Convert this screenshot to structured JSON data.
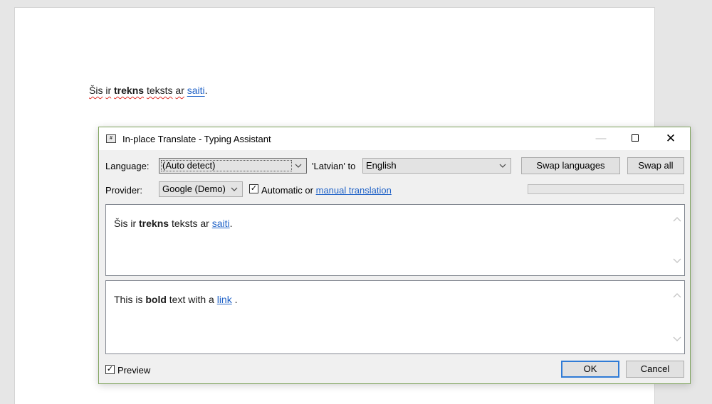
{
  "document": {
    "word_sis": "Šis",
    "word_ir": "ir",
    "word_trekns": "trekns",
    "word_teksts": "teksts",
    "word_ar": "ar",
    "word_saiti": "saiti",
    "punct": "."
  },
  "dialog": {
    "title": "In-place Translate - Typing Assistant",
    "icon_glyph": "#"
  },
  "controls": {
    "language_label": "Language:",
    "source_language": "(Auto detect)",
    "detected_to": "'Latvian' to",
    "target_language": "English",
    "swap_languages": "Swap languages",
    "swap_all": "Swap all",
    "provider_label": "Provider:",
    "provider": "Google (Demo)",
    "automatic_label": "Automatic or",
    "manual_link": "manual translation",
    "automatic_checked": "✓"
  },
  "source_text": {
    "pre": "Šis ir",
    "bold": "trekns",
    "mid": "teksts ar",
    "link": "saiti",
    "post": "."
  },
  "target_text": {
    "pre": "This is",
    "bold": "bold",
    "mid": "text with a",
    "link": "link",
    "post": " ."
  },
  "footer": {
    "preview_label": "Preview",
    "preview_checked": "✓",
    "ok": "OK",
    "cancel": "Cancel"
  },
  "colors": {
    "link": "#2264c8",
    "dialog_border": "#7fa35d",
    "primary_button_border": "#2f7bd6",
    "spell_underline": "#e0302a"
  }
}
